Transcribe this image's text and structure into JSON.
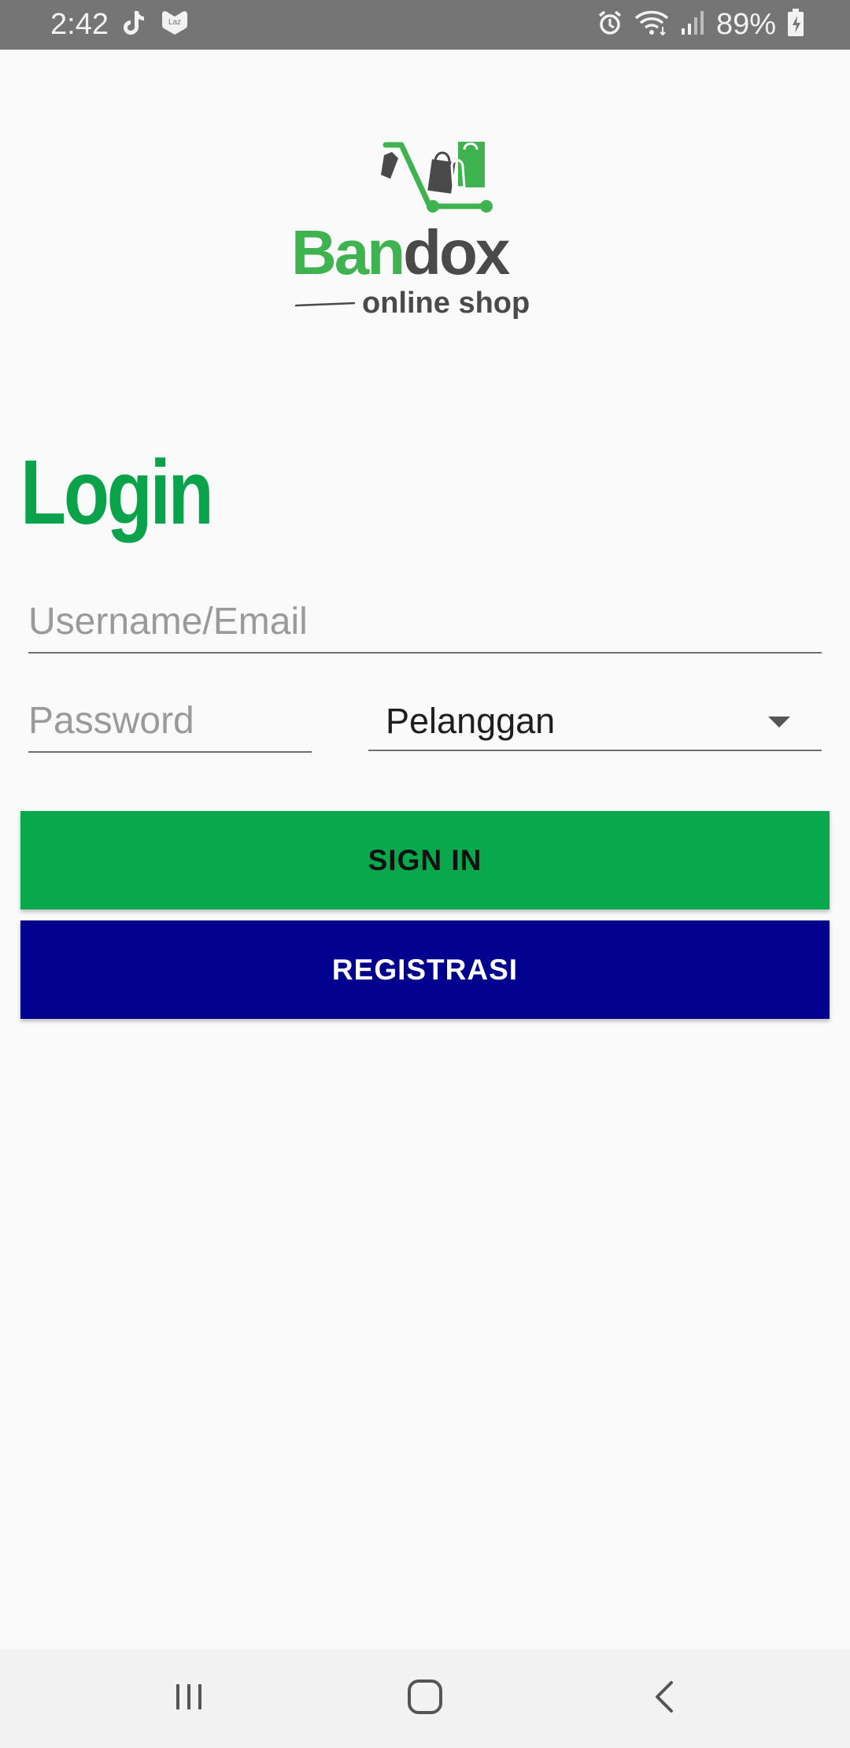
{
  "status_bar": {
    "time": "2:42",
    "battery_percent": "89%",
    "left_icons": [
      "tiktok-icon",
      "lazada-icon"
    ],
    "right_icons": [
      "alarm-icon",
      "wifi-icon",
      "signal-icon",
      "battery-charging-icon"
    ]
  },
  "logo": {
    "brand_part1": "Ban",
    "brand_part2": "dox",
    "tagline": "online shop",
    "colors": {
      "green": "#3fb34f",
      "gray": "#4a4a4a"
    }
  },
  "login": {
    "title": "Login",
    "username_placeholder": "Username/Email",
    "password_placeholder": "Password",
    "role_selected": "Pelanggan",
    "signin_label": "SIGN IN",
    "register_label": "REGISTRASI"
  },
  "colors": {
    "accent_green": "#0aa24a",
    "signin_bg": "#08a84c",
    "register_bg": "#02028e"
  },
  "nav_bar": {
    "buttons": [
      "recent-apps-icon",
      "home-icon",
      "back-icon"
    ]
  }
}
